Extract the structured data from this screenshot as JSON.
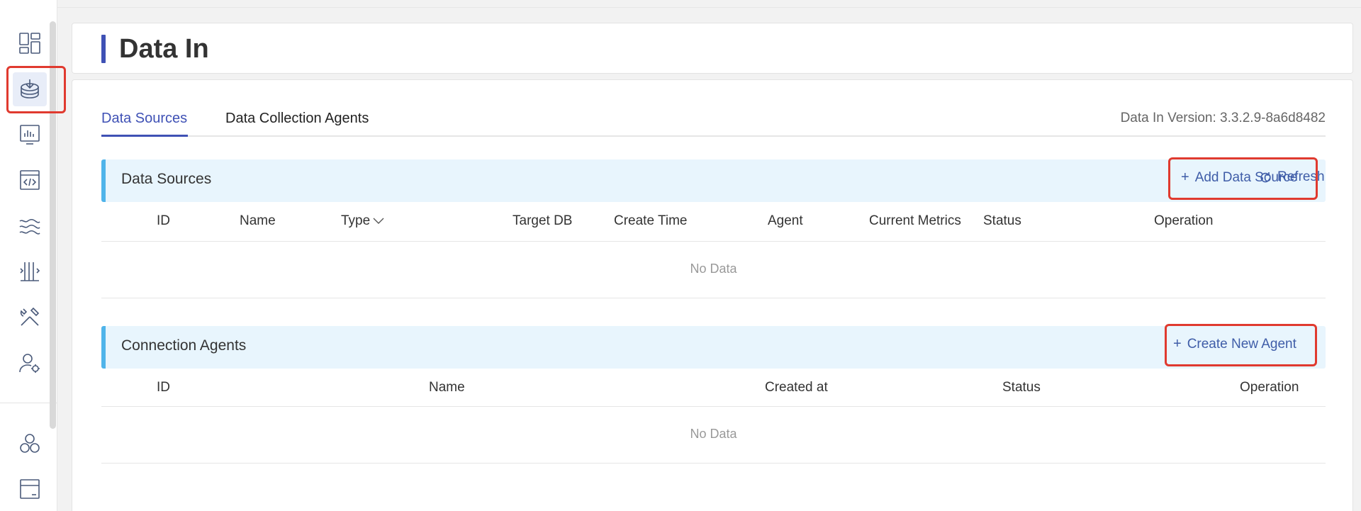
{
  "sidebar": {
    "items": [
      {
        "icon": "dashboard-icon"
      },
      {
        "icon": "data-in-icon",
        "active": true
      },
      {
        "icon": "monitor-chart-icon"
      },
      {
        "icon": "code-window-icon"
      },
      {
        "icon": "stream-waves-icon"
      },
      {
        "icon": "pipeline-icon"
      },
      {
        "icon": "tools-icon"
      },
      {
        "icon": "user-settings-icon"
      },
      {
        "icon": "cluster-icon"
      },
      {
        "icon": "panel-icon"
      }
    ]
  },
  "header": {
    "title": "Data In"
  },
  "tabs": [
    {
      "label": "Data Sources",
      "active": true
    },
    {
      "label": "Data Collection Agents",
      "active": false
    }
  ],
  "version_text": "Data In Version: 3.3.2.9-8a6d8482",
  "data_sources": {
    "title": "Data Sources",
    "refresh_label": "Refresh",
    "add_label": "Add Data Source",
    "columns": [
      "ID",
      "Name",
      "Type",
      "Target DB",
      "Create Time",
      "Agent",
      "Current Metrics",
      "Status",
      "Operation"
    ],
    "empty_text": "No Data"
  },
  "agents": {
    "title": "Connection Agents",
    "create_label": "Create New Agent",
    "columns": [
      "ID",
      "Name",
      "Created at",
      "Status",
      "Operation"
    ],
    "empty_text": "No Data"
  },
  "colors": {
    "accent": "#3f51b5",
    "section_bg": "#e8f5fd",
    "section_border": "#4fb4ea",
    "highlight": "#e03a2f"
  }
}
